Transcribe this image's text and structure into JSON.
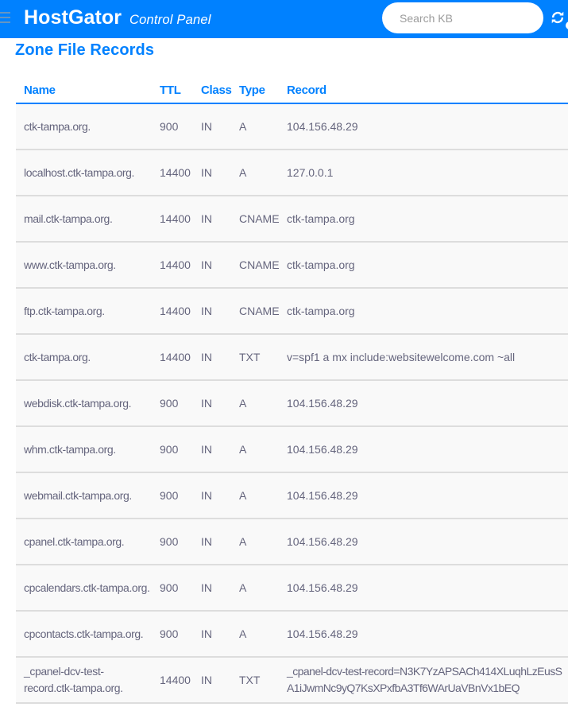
{
  "header": {
    "brand": "HostGator",
    "brand_suffix": "Control Panel",
    "search_placeholder": "Search KB",
    "colors": {
      "bar": "#0081ff"
    }
  },
  "page": {
    "title": "Zone File Records"
  },
  "table": {
    "columns": [
      "Name",
      "TTL",
      "Class",
      "Type",
      "Record"
    ],
    "rows": [
      [
        "ctk-tampa.org.",
        "900",
        "IN",
        "A",
        "104.156.48.29"
      ],
      [
        "localhost.ctk-tampa.org.",
        "14400",
        "IN",
        "A",
        "127.0.0.1"
      ],
      [
        "mail.ctk-tampa.org.",
        "14400",
        "IN",
        "CNAME",
        "ctk-tampa.org"
      ],
      [
        "www.ctk-tampa.org.",
        "14400",
        "IN",
        "CNAME",
        "ctk-tampa.org"
      ],
      [
        "ftp.ctk-tampa.org.",
        "14400",
        "IN",
        "CNAME",
        "ctk-tampa.org"
      ],
      [
        "ctk-tampa.org.",
        "14400",
        "IN",
        "TXT",
        "v=spf1 a mx include:websitewelcome.com ~all"
      ],
      [
        "webdisk.ctk-tampa.org.",
        "900",
        "IN",
        "A",
        "104.156.48.29"
      ],
      [
        "whm.ctk-tampa.org.",
        "900",
        "IN",
        "A",
        "104.156.48.29"
      ],
      [
        "webmail.ctk-tampa.org.",
        "900",
        "IN",
        "A",
        "104.156.48.29"
      ],
      [
        "cpanel.ctk-tampa.org.",
        "900",
        "IN",
        "A",
        "104.156.48.29"
      ],
      [
        "cpcalendars.ctk-tampa.org.",
        "900",
        "IN",
        "A",
        "104.156.48.29"
      ],
      [
        "cpcontacts.ctk-tampa.org.",
        "900",
        "IN",
        "A",
        "104.156.48.29"
      ],
      [
        "_cpanel-dcv-test-record.ctk-tampa.org.",
        "14400",
        "IN",
        "TXT",
        "_cpanel-dcv-test-record=N3K7YzAPSACh414XLuqhLzEusSA1iJwmNc9yQ7KsXPxfbA3Tf6WArUaVBnVx1bEQ"
      ]
    ]
  }
}
